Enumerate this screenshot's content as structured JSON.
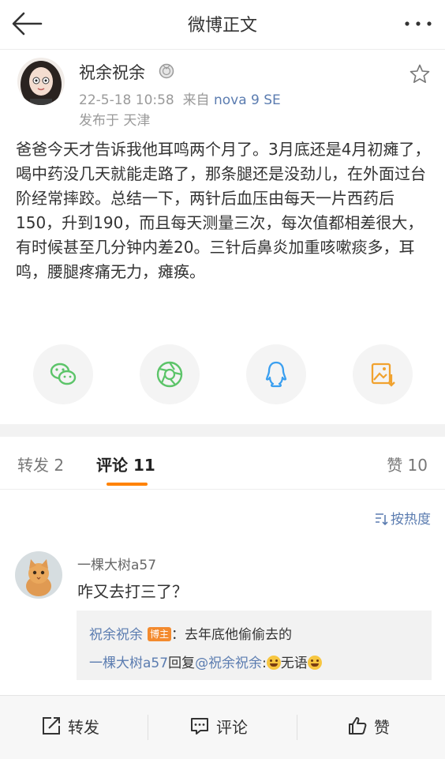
{
  "header": {
    "title": "微博正文",
    "back_icon": "back-arrow-icon",
    "more_icon": "more-dots-icon"
  },
  "post": {
    "author": "祝余祝余",
    "medal_icon": "medal-icon",
    "time": "22-5-18 10:58",
    "source_prefix": "来自",
    "source": "nova 9 SE",
    "location": "发布于 天津",
    "text": "爸爸今天才告诉我他耳鸣两个月了。3月底还是4月初瘫了，喝中药没几天就能走路了，那条腿还是没劲儿，在外面过台阶经常摔跤。总结一下，两针后血压由每天一片西药后150，升到190，而且每天测量三次，每次值都相差很大，有时候甚至几分钟内差20。三针后鼻炎加重咳嗽痰多，耳鸣，腰腿疼痛无力，瘫痪。"
  },
  "share": [
    {
      "name": "wechat",
      "icon": "wechat-icon",
      "color": "#5cc469"
    },
    {
      "name": "moments",
      "icon": "moments-icon",
      "color": "#5cc469"
    },
    {
      "name": "qq",
      "icon": "qq-icon",
      "color": "#3a9ff0"
    },
    {
      "name": "save-image",
      "icon": "save-image-icon",
      "color": "#f1a22e"
    }
  ],
  "tabs": {
    "repost": "转发 2",
    "comment": "评论 11",
    "like": "赞 10"
  },
  "sort_label": "按热度",
  "comment": {
    "user": "一棵大树a57",
    "text": "咋又去打三了？",
    "replies": [
      {
        "user": "祝余祝余",
        "badge": "博主",
        "text": "：去年底他偷偷去的"
      },
      {
        "user": "一棵大树a57",
        "mid": "回复",
        "target": "@祝余祝余",
        "sep": ":",
        "text": "无语"
      }
    ]
  },
  "bottom_bar": {
    "repost": "转发",
    "comment": "评论",
    "like": "赞"
  },
  "colors": {
    "accent": "#ff8200",
    "link": "#5b7cb0"
  }
}
